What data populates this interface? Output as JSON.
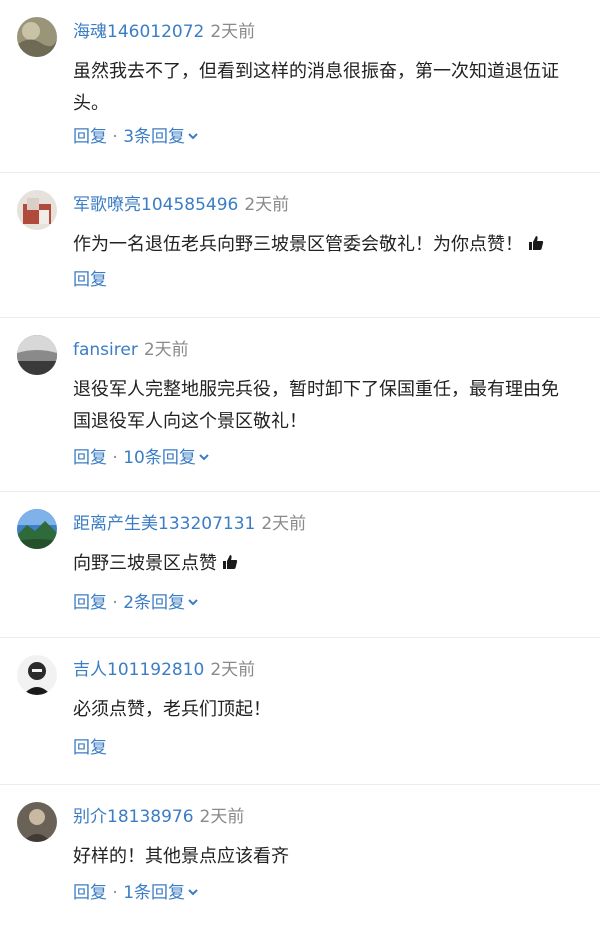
{
  "comments": [
    {
      "username": "海魂146012072",
      "time": "2天前",
      "content_lines": [
        "虽然我去不了，但看到这样的消息很振奋，第一次知道退伍证",
        "头。"
      ],
      "reply_label": "回复",
      "separator": "·",
      "replies_label": "3条回复"
    },
    {
      "username": "军歌嘹亮104585496",
      "time": "2天前",
      "content_lines": [
        "作为一名退伍老兵向野三坡景区管委会敬礼！为你点赞！"
      ],
      "reply_label": "回复"
    },
    {
      "username": "fansirer",
      "time": "2天前",
      "content_lines": [
        "退役军人完整地服完兵役，暂时卸下了保国重任，最有理由免",
        "国退役军人向这个景区敬礼！"
      ],
      "reply_label": "回复",
      "separator": "·",
      "replies_label": "10条回复"
    },
    {
      "username": "距离产生美133207131",
      "time": "2天前",
      "content_lines": [
        "向野三坡景区点赞"
      ],
      "reply_label": "回复",
      "separator": "·",
      "replies_label": "2条回复"
    },
    {
      "username": "吉人101192810",
      "time": "2天前",
      "content_lines": [
        "必须点赞，老兵们顶起！"
      ],
      "reply_label": "回复"
    },
    {
      "username": "别介18138976",
      "time": "2天前",
      "content_lines": [
        "好样的！其他景点应该看齐"
      ],
      "reply_label": "回复",
      "separator": "·",
      "replies_label": "1条回复"
    }
  ],
  "colors": {
    "username": "#3b7dc4",
    "time": "#8a8a8a",
    "text": "#222222",
    "divider": "#ececec"
  },
  "icons": {
    "thumbs_up": "thumbs-up-icon",
    "chevron": "chevron-down-icon"
  }
}
